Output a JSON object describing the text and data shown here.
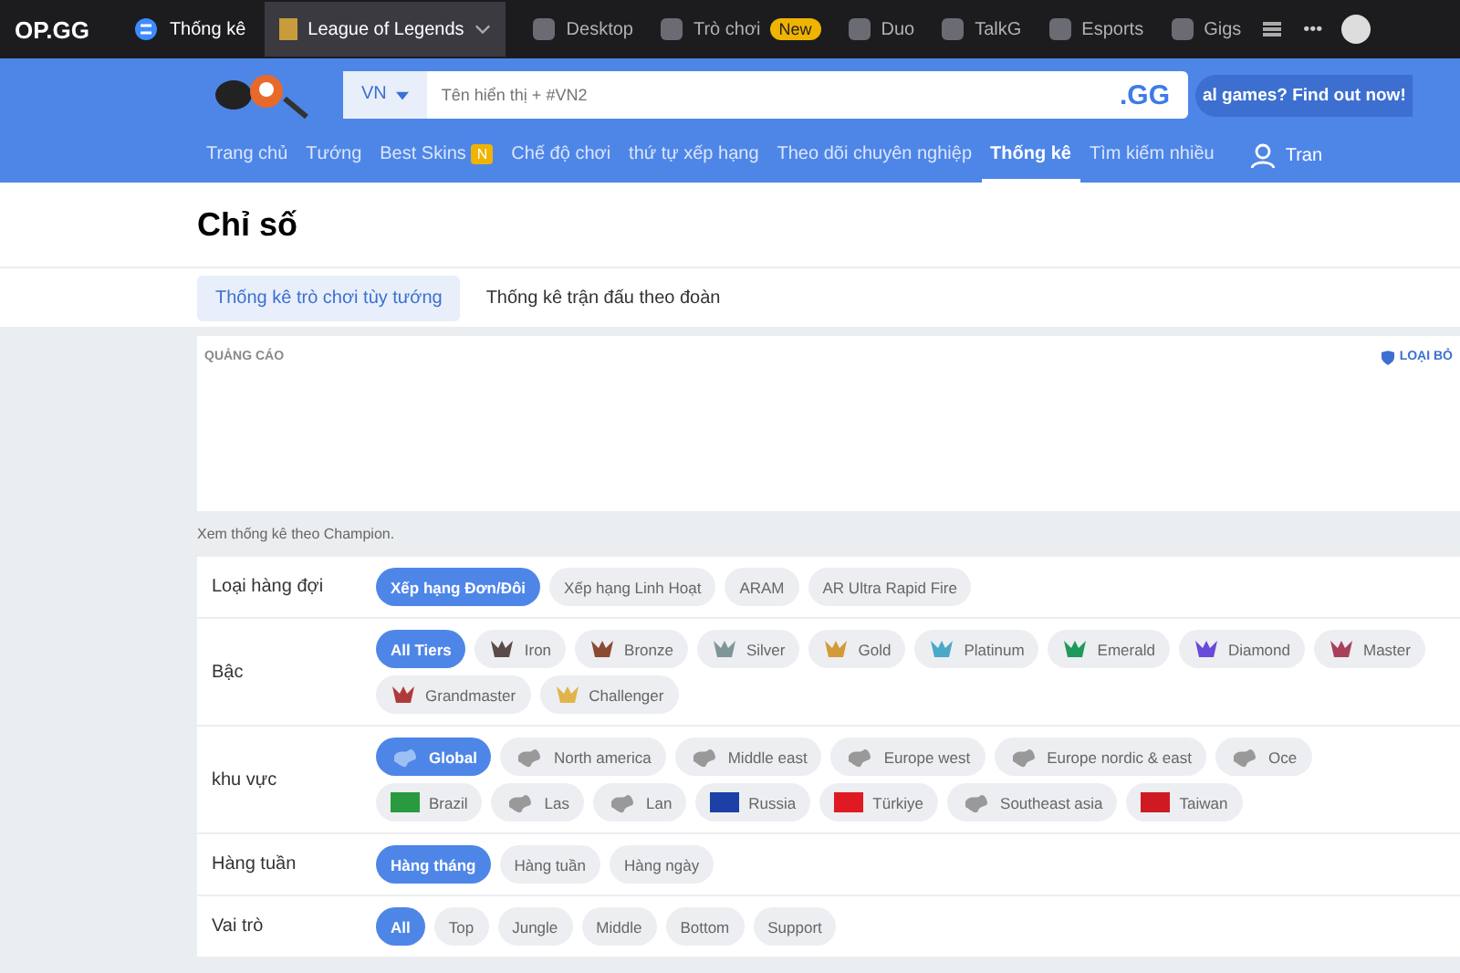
{
  "topbar": {
    "logo": "OP.GG",
    "section": "Thống kê",
    "game": "League of Legends",
    "items": [
      {
        "label": "Desktop"
      },
      {
        "label": "Trò chơi",
        "badge": "New"
      },
      {
        "label": "Duo"
      },
      {
        "label": "TalkG"
      },
      {
        "label": "Esports"
      },
      {
        "label": "Gigs"
      }
    ],
    "more": "•••"
  },
  "search": {
    "region": "VN",
    "placeholder": "Tên hiển thị + #VN2",
    "suffix": ".GG",
    "promo": "al games? Find out now!"
  },
  "nav": [
    {
      "label": "Trang chủ",
      "selected": false
    },
    {
      "label": "Tướng",
      "selected": false
    },
    {
      "label": "Best Skins",
      "selected": false,
      "badge": "N"
    },
    {
      "label": "Chế độ chơi",
      "selected": false
    },
    {
      "label": "thứ tự xếp hạng",
      "selected": false
    },
    {
      "label": "Theo dõi chuyên nghiệp",
      "selected": false
    },
    {
      "label": "Thống kê",
      "selected": true
    },
    {
      "label": "Tìm kiếm nhiều",
      "selected": false
    }
  ],
  "user": "Tran",
  "title": "Chỉ số",
  "tabs": [
    {
      "label": "Thống kê trò chơi tùy tướng",
      "selected": true
    },
    {
      "label": "Thống kê trận đấu theo đoàn",
      "selected": false
    }
  ],
  "ad": {
    "label": "QUẢNG CÁO",
    "remove": "LOẠI BỎ"
  },
  "hint": "Xem thống kê theo Champion.",
  "filters": [
    {
      "label": "Loại hàng đợi",
      "lines": [
        [
          {
            "label": "Xếp hạng Đơn/Đôi",
            "selected": true,
            "kind": "plain"
          },
          {
            "label": "Xếp hạng Linh Hoạt",
            "selected": false,
            "kind": "plain"
          },
          {
            "label": "ARAM",
            "selected": false,
            "kind": "plain"
          },
          {
            "label": "AR Ultra Rapid Fire",
            "selected": false,
            "kind": "plain"
          }
        ]
      ]
    },
    {
      "label": "Bậc",
      "lines": [
        [
          {
            "label": "All Tiers",
            "selected": true,
            "kind": "plain"
          },
          {
            "label": "Iron",
            "selected": false,
            "kind": "emblem",
            "color": "#5a4a48"
          },
          {
            "label": "Bronze",
            "selected": false,
            "kind": "emblem",
            "color": "#8c4a32"
          },
          {
            "label": "Silver",
            "selected": false,
            "kind": "emblem",
            "color": "#80959a"
          },
          {
            "label": "Gold",
            "selected": false,
            "kind": "emblem",
            "color": "#d49a3a"
          },
          {
            "label": "Platinum",
            "selected": false,
            "kind": "emblem",
            "color": "#4aa8c8"
          },
          {
            "label": "Emerald",
            "selected": false,
            "kind": "emblem",
            "color": "#1f9a5a"
          },
          {
            "label": "Diamond",
            "selected": false,
            "kind": "emblem",
            "color": "#6a4ad8"
          },
          {
            "label": "Master",
            "selected": false,
            "kind": "emblem",
            "color": "#a8405a"
          }
        ],
        [
          {
            "label": "Grandmaster",
            "selected": false,
            "kind": "emblem",
            "color": "#b03a3a"
          },
          {
            "label": "Challenger",
            "selected": false,
            "kind": "emblem",
            "color": "#e0b44a"
          }
        ]
      ]
    },
    {
      "label": "khu vực",
      "lines": [
        [
          {
            "label": "Global",
            "selected": true,
            "kind": "map"
          },
          {
            "label": "North america",
            "selected": false,
            "kind": "map"
          },
          {
            "label": "Middle east",
            "selected": false,
            "kind": "map"
          },
          {
            "label": "Europe west",
            "selected": false,
            "kind": "map"
          },
          {
            "label": "Europe nordic & east",
            "selected": false,
            "kind": "map"
          },
          {
            "label": "Oce",
            "selected": false,
            "kind": "map"
          }
        ],
        [
          {
            "label": "Brazil",
            "selected": false,
            "kind": "flag",
            "color": "#2a9a40"
          },
          {
            "label": "Las",
            "selected": false,
            "kind": "map"
          },
          {
            "label": "Lan",
            "selected": false,
            "kind": "map"
          },
          {
            "label": "Russia",
            "selected": false,
            "kind": "flag",
            "color": "#1c3fa8"
          },
          {
            "label": "Türkiye",
            "selected": false,
            "kind": "flag",
            "color": "#e01a22"
          },
          {
            "label": "Southeast asia",
            "selected": false,
            "kind": "map"
          },
          {
            "label": "Taiwan",
            "selected": false,
            "kind": "flag",
            "color": "#d01a22"
          }
        ]
      ]
    },
    {
      "label": "Hàng tuần",
      "lines": [
        [
          {
            "label": "Hàng tháng",
            "selected": true,
            "kind": "plain"
          },
          {
            "label": "Hàng tuần",
            "selected": false,
            "kind": "plain"
          },
          {
            "label": "Hàng ngày",
            "selected": false,
            "kind": "plain"
          }
        ]
      ]
    },
    {
      "label": "Vai trò",
      "lines": [
        [
          {
            "label": "All",
            "selected": true,
            "kind": "plain"
          },
          {
            "label": "Top",
            "selected": false,
            "kind": "plain"
          },
          {
            "label": "Jungle",
            "selected": false,
            "kind": "plain"
          },
          {
            "label": "Middle",
            "selected": false,
            "kind": "plain"
          },
          {
            "label": "Bottom",
            "selected": false,
            "kind": "plain"
          },
          {
            "label": "Support",
            "selected": false,
            "kind": "plain"
          }
        ]
      ]
    }
  ]
}
